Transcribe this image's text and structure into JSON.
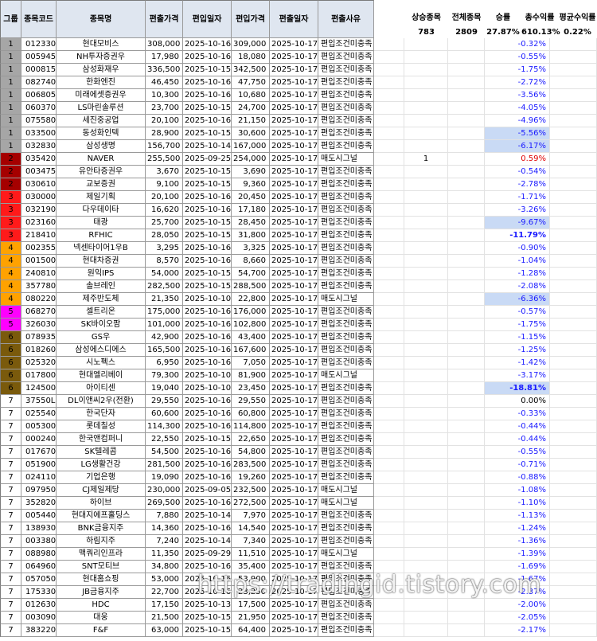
{
  "headers": {
    "group": "그룹",
    "code": "종목코드",
    "name": "종목명",
    "in_price": "편출가격",
    "in_date": "편입일자",
    "entry_price": "편입가격",
    "out_date": "편출일자",
    "reason": "편출사유"
  },
  "summary": {
    "labels": [
      "상승종목",
      "전체종목",
      "승률",
      "총수익률",
      "평균수익률"
    ],
    "values": [
      "783",
      "2809",
      "27.87%",
      "610.13%",
      "0.22%"
    ]
  },
  "group_colors": {
    "1": "#a6a6a6",
    "2": "#a50000",
    "3": "#ff1a1a",
    "4": "#ffa200",
    "5": "#ff00ff",
    "6": "#7a5a0c",
    "7": "#ffffff"
  },
  "rows": [
    {
      "g": "1",
      "code": "012330",
      "name": "현대모비스",
      "p1": "308,000",
      "d1": "2025-10-16",
      "p2": "309,000",
      "d2": "2025-10-17",
      "reason": "편입조건미충족",
      "extra": "",
      "ret": "-0.32%",
      "hl": false,
      "bold": false
    },
    {
      "g": "1",
      "code": "005945",
      "name": "NH투자증권우",
      "p1": "17,980",
      "d1": "2025-10-16",
      "p2": "18,080",
      "d2": "2025-10-17",
      "reason": "편입조건미충족",
      "extra": "",
      "ret": "-0.55%",
      "hl": false,
      "bold": false
    },
    {
      "g": "1",
      "code": "000815",
      "name": "삼성화재우",
      "p1": "336,500",
      "d1": "2025-10-15",
      "p2": "342,500",
      "d2": "2025-10-17",
      "reason": "편입조건미충족",
      "extra": "",
      "ret": "-1.75%",
      "hl": false,
      "bold": false
    },
    {
      "g": "1",
      "code": "082740",
      "name": "한화엔진",
      "p1": "46,450",
      "d1": "2025-10-16",
      "p2": "47,750",
      "d2": "2025-10-17",
      "reason": "편입조건미충족",
      "extra": "",
      "ret": "-2.72%",
      "hl": false,
      "bold": false
    },
    {
      "g": "1",
      "code": "006805",
      "name": "미래에셋증권우",
      "p1": "10,300",
      "d1": "2025-10-16",
      "p2": "10,680",
      "d2": "2025-10-17",
      "reason": "편입조건미충족",
      "extra": "",
      "ret": "-3.56%",
      "hl": false,
      "bold": false
    },
    {
      "g": "1",
      "code": "060370",
      "name": "LS마린솔루션",
      "p1": "23,700",
      "d1": "2025-10-15",
      "p2": "24,700",
      "d2": "2025-10-17",
      "reason": "편입조건미충족",
      "extra": "",
      "ret": "-4.05%",
      "hl": false,
      "bold": false
    },
    {
      "g": "1",
      "code": "075580",
      "name": "세진중공업",
      "p1": "20,100",
      "d1": "2025-10-16",
      "p2": "21,150",
      "d2": "2025-10-17",
      "reason": "편입조건미충족",
      "extra": "",
      "ret": "-4.96%",
      "hl": false,
      "bold": false
    },
    {
      "g": "1",
      "code": "033500",
      "name": "동성화인텍",
      "p1": "28,900",
      "d1": "2025-10-15",
      "p2": "30,600",
      "d2": "2025-10-17",
      "reason": "편입조건미충족",
      "extra": "",
      "ret": "-5.56%",
      "hl": true,
      "bold": false
    },
    {
      "g": "1",
      "code": "032830",
      "name": "삼성생명",
      "p1": "156,700",
      "d1": "2025-10-14",
      "p2": "167,000",
      "d2": "2025-10-17",
      "reason": "편입조건미충족",
      "extra": "",
      "ret": "-6.17%",
      "hl": true,
      "bold": false
    },
    {
      "g": "2",
      "code": "035420",
      "name": "NAVER",
      "p1": "255,500",
      "d1": "2025-09-25",
      "p2": "254,000",
      "d2": "2025-10-17",
      "reason": "매도시그널",
      "extra": "1",
      "ret": "0.59%",
      "hl": false,
      "bold": false
    },
    {
      "g": "2",
      "code": "003475",
      "name": "유안타증권우",
      "p1": "3,670",
      "d1": "2025-10-15",
      "p2": "3,690",
      "d2": "2025-10-17",
      "reason": "편입조건미충족",
      "extra": "",
      "ret": "-0.54%",
      "hl": false,
      "bold": false
    },
    {
      "g": "2",
      "code": "030610",
      "name": "교보증권",
      "p1": "9,100",
      "d1": "2025-10-15",
      "p2": "9,360",
      "d2": "2025-10-17",
      "reason": "편입조건미충족",
      "extra": "",
      "ret": "-2.78%",
      "hl": false,
      "bold": false
    },
    {
      "g": "3",
      "code": "030000",
      "name": "제일기획",
      "p1": "20,100",
      "d1": "2025-10-16",
      "p2": "20,450",
      "d2": "2025-10-17",
      "reason": "편입조건미충족",
      "extra": "",
      "ret": "-1.71%",
      "hl": false,
      "bold": false
    },
    {
      "g": "3",
      "code": "032190",
      "name": "다우데이타",
      "p1": "16,620",
      "d1": "2025-10-16",
      "p2": "17,180",
      "d2": "2025-10-17",
      "reason": "편입조건미충족",
      "extra": "",
      "ret": "-3.26%",
      "hl": false,
      "bold": false
    },
    {
      "g": "3",
      "code": "023160",
      "name": "태광",
      "p1": "25,700",
      "d1": "2025-10-15",
      "p2": "28,450",
      "d2": "2025-10-17",
      "reason": "편입조건미충족",
      "extra": "",
      "ret": "-9.67%",
      "hl": true,
      "bold": false
    },
    {
      "g": "3",
      "code": "218410",
      "name": "RFHIC",
      "p1": "28,050",
      "d1": "2025-10-15",
      "p2": "31,800",
      "d2": "2025-10-17",
      "reason": "편입조건미충족",
      "extra": "",
      "ret": "-11.79%",
      "hl": false,
      "bold": true
    },
    {
      "g": "4",
      "code": "002355",
      "name": "넥센타이어1우B",
      "p1": "3,295",
      "d1": "2025-10-16",
      "p2": "3,325",
      "d2": "2025-10-17",
      "reason": "편입조건미충족",
      "extra": "",
      "ret": "-0.90%",
      "hl": false,
      "bold": false
    },
    {
      "g": "4",
      "code": "001500",
      "name": "현대차증권",
      "p1": "8,570",
      "d1": "2025-10-16",
      "p2": "8,660",
      "d2": "2025-10-17",
      "reason": "편입조건미충족",
      "extra": "",
      "ret": "-1.04%",
      "hl": false,
      "bold": false
    },
    {
      "g": "4",
      "code": "240810",
      "name": "원익IPS",
      "p1": "54,000",
      "d1": "2025-10-15",
      "p2": "54,700",
      "d2": "2025-10-17",
      "reason": "편입조건미충족",
      "extra": "",
      "ret": "-1.28%",
      "hl": false,
      "bold": false
    },
    {
      "g": "4",
      "code": "357780",
      "name": "솔브레인",
      "p1": "282,500",
      "d1": "2025-10-15",
      "p2": "288,500",
      "d2": "2025-10-17",
      "reason": "편입조건미충족",
      "extra": "",
      "ret": "-2.08%",
      "hl": false,
      "bold": false
    },
    {
      "g": "4",
      "code": "080220",
      "name": "제주반도체",
      "p1": "21,350",
      "d1": "2025-10-10",
      "p2": "22,800",
      "d2": "2025-10-17",
      "reason": "매도시그널",
      "extra": "",
      "ret": "-6.36%",
      "hl": true,
      "bold": false
    },
    {
      "g": "5",
      "code": "068270",
      "name": "셀트리온",
      "p1": "175,000",
      "d1": "2025-10-16",
      "p2": "176,000",
      "d2": "2025-10-17",
      "reason": "편입조건미충족",
      "extra": "",
      "ret": "-0.57%",
      "hl": false,
      "bold": false
    },
    {
      "g": "5",
      "code": "326030",
      "name": "SK바이오팜",
      "p1": "101,000",
      "d1": "2025-10-16",
      "p2": "102,800",
      "d2": "2025-10-17",
      "reason": "편입조건미충족",
      "extra": "",
      "ret": "-1.75%",
      "hl": false,
      "bold": false
    },
    {
      "g": "6",
      "code": "078935",
      "name": "GS우",
      "p1": "42,900",
      "d1": "2025-10-16",
      "p2": "43,400",
      "d2": "2025-10-17",
      "reason": "편입조건미충족",
      "extra": "",
      "ret": "-1.15%",
      "hl": false,
      "bold": false
    },
    {
      "g": "6",
      "code": "018260",
      "name": "삼성에스디에스",
      "p1": "165,500",
      "d1": "2025-10-16",
      "p2": "167,600",
      "d2": "2025-10-17",
      "reason": "편입조건미충족",
      "extra": "",
      "ret": "-1.25%",
      "hl": false,
      "bold": false
    },
    {
      "g": "6",
      "code": "025320",
      "name": "시노펙스",
      "p1": "6,950",
      "d1": "2025-10-16",
      "p2": "7,050",
      "d2": "2025-10-17",
      "reason": "편입조건미충족",
      "extra": "",
      "ret": "-1.42%",
      "hl": false,
      "bold": false
    },
    {
      "g": "6",
      "code": "017800",
      "name": "현대엘리베이",
      "p1": "79,300",
      "d1": "2025-10-10",
      "p2": "81,900",
      "d2": "2025-10-17",
      "reason": "매도시그널",
      "extra": "",
      "ret": "-3.17%",
      "hl": false,
      "bold": false
    },
    {
      "g": "6",
      "code": "124500",
      "name": "아이티센",
      "p1": "19,040",
      "d1": "2025-10-10",
      "p2": "23,450",
      "d2": "2025-10-17",
      "reason": "편입조건미충족",
      "extra": "",
      "ret": "-18.81%",
      "hl": true,
      "bold": true
    },
    {
      "g": "7",
      "code": "37550L",
      "name": "DL이앤씨2우(전환)",
      "p1": "29,550",
      "d1": "2025-10-16",
      "p2": "29,550",
      "d2": "2025-10-17",
      "reason": "편입조건미충족",
      "extra": "",
      "ret": "0.00%",
      "hl": false,
      "bold": false
    },
    {
      "g": "7",
      "code": "025540",
      "name": "한국단자",
      "p1": "60,600",
      "d1": "2025-10-16",
      "p2": "60,800",
      "d2": "2025-10-17",
      "reason": "편입조건미충족",
      "extra": "",
      "ret": "-0.33%",
      "hl": false,
      "bold": false
    },
    {
      "g": "7",
      "code": "005300",
      "name": "롯데칠성",
      "p1": "114,300",
      "d1": "2025-10-16",
      "p2": "114,800",
      "d2": "2025-10-17",
      "reason": "편입조건미충족",
      "extra": "",
      "ret": "-0.44%",
      "hl": false,
      "bold": false
    },
    {
      "g": "7",
      "code": "000240",
      "name": "한국앤컴퍼니",
      "p1": "22,550",
      "d1": "2025-10-15",
      "p2": "22,650",
      "d2": "2025-10-17",
      "reason": "편입조건미충족",
      "extra": "",
      "ret": "-0.44%",
      "hl": false,
      "bold": false
    },
    {
      "g": "7",
      "code": "017670",
      "name": "SK텔레콤",
      "p1": "54,500",
      "d1": "2025-10-16",
      "p2": "54,800",
      "d2": "2025-10-17",
      "reason": "편입조건미충족",
      "extra": "",
      "ret": "-0.55%",
      "hl": false,
      "bold": false
    },
    {
      "g": "7",
      "code": "051900",
      "name": "LG생활건강",
      "p1": "281,500",
      "d1": "2025-10-16",
      "p2": "283,500",
      "d2": "2025-10-17",
      "reason": "편입조건미충족",
      "extra": "",
      "ret": "-0.71%",
      "hl": false,
      "bold": false
    },
    {
      "g": "7",
      "code": "024110",
      "name": "기업은행",
      "p1": "19,090",
      "d1": "2025-10-16",
      "p2": "19,260",
      "d2": "2025-10-17",
      "reason": "편입조건미충족",
      "extra": "",
      "ret": "-0.88%",
      "hl": false,
      "bold": false
    },
    {
      "g": "7",
      "code": "097950",
      "name": "CJ제일제당",
      "p1": "230,000",
      "d1": "2025-09-05",
      "p2": "232,500",
      "d2": "2025-10-17",
      "reason": "매도시그널",
      "extra": "",
      "ret": "-1.08%",
      "hl": false,
      "bold": false
    },
    {
      "g": "7",
      "code": "352820",
      "name": "하이브",
      "p1": "269,500",
      "d1": "2025-10-16",
      "p2": "272,500",
      "d2": "2025-10-17",
      "reason": "매도시그널",
      "extra": "",
      "ret": "-1.10%",
      "hl": false,
      "bold": false
    },
    {
      "g": "7",
      "code": "005440",
      "name": "현대지에프홀딩스",
      "p1": "7,880",
      "d1": "2025-10-14",
      "p2": "7,970",
      "d2": "2025-10-17",
      "reason": "편입조건미충족",
      "extra": "",
      "ret": "-1.13%",
      "hl": false,
      "bold": false
    },
    {
      "g": "7",
      "code": "138930",
      "name": "BNK금융지주",
      "p1": "14,360",
      "d1": "2025-10-16",
      "p2": "14,540",
      "d2": "2025-10-17",
      "reason": "편입조건미충족",
      "extra": "",
      "ret": "-1.24%",
      "hl": false,
      "bold": false
    },
    {
      "g": "7",
      "code": "003380",
      "name": "하림지주",
      "p1": "7,240",
      "d1": "2025-10-14",
      "p2": "7,340",
      "d2": "2025-10-17",
      "reason": "편입조건미충족",
      "extra": "",
      "ret": "-1.36%",
      "hl": false,
      "bold": false
    },
    {
      "g": "7",
      "code": "088980",
      "name": "맥쿼리인프라",
      "p1": "11,350",
      "d1": "2025-09-29",
      "p2": "11,510",
      "d2": "2025-10-17",
      "reason": "매도시그널",
      "extra": "",
      "ret": "-1.39%",
      "hl": false,
      "bold": false
    },
    {
      "g": "7",
      "code": "064960",
      "name": "SNT모티브",
      "p1": "34,800",
      "d1": "2025-10-16",
      "p2": "35,400",
      "d2": "2025-10-17",
      "reason": "편입조건미충족",
      "extra": "",
      "ret": "-1.69%",
      "hl": false,
      "bold": false
    },
    {
      "g": "7",
      "code": "057050",
      "name": "현대홈쇼핑",
      "p1": "53,000",
      "d1": "2025-10-16",
      "p2": "53,900",
      "d2": "2025-10-17",
      "reason": "편입조건미충족",
      "extra": "",
      "ret": "-1.67%",
      "hl": false,
      "bold": false
    },
    {
      "g": "7",
      "code": "175330",
      "name": "JB금융지주",
      "p1": "22,700",
      "d1": "2025-10-16",
      "p2": "23,250",
      "d2": "2025-10-17",
      "reason": "편입조건미충족",
      "extra": "",
      "ret": "-2.37%",
      "hl": false,
      "bold": false
    },
    {
      "g": "7",
      "code": "012630",
      "name": "HDC",
      "p1": "17,150",
      "d1": "2025-10-13",
      "p2": "17,500",
      "d2": "2025-10-17",
      "reason": "편입조건미충족",
      "extra": "",
      "ret": "-2.00%",
      "hl": false,
      "bold": false
    },
    {
      "g": "7",
      "code": "003090",
      "name": "대웅",
      "p1": "21,500",
      "d1": "2025-10-15",
      "p2": "21,950",
      "d2": "2025-10-17",
      "reason": "편입조건미충족",
      "extra": "",
      "ret": "-2.05%",
      "hl": false,
      "bold": false
    },
    {
      "g": "7",
      "code": "383220",
      "name": "F&F",
      "p1": "63,000",
      "d1": "2025-10-15",
      "p2": "64,400",
      "d2": "2025-10-17",
      "reason": "편입조건미충족",
      "extra": "",
      "ret": "-2.17%",
      "hl": false,
      "bold": false
    }
  ],
  "watermark": "https://tradingid.tistory.com"
}
